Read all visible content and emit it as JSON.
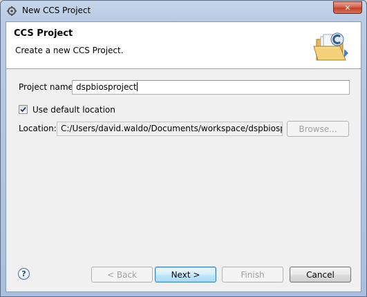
{
  "window": {
    "title": "New CCS Project",
    "close_symbol": "✕"
  },
  "header": {
    "title": "CCS Project",
    "description": "Create a new CCS Project.",
    "banner_icon": "folder-wizard-icon"
  },
  "form": {
    "project_name_label": "Project name:",
    "project_name_value": "dspbiosproject",
    "use_default_label": "Use default location",
    "use_default_checked": true,
    "location_label": "Location:",
    "location_value": "C:/Users/david.waldo/Documents/workspace/dspbiosprojec",
    "browse_label": "Browse..."
  },
  "buttons": {
    "help_symbol": "?",
    "back_label": "< Back",
    "next_label": "Next >",
    "finish_label": "Finish",
    "cancel_label": "Cancel"
  },
  "colors": {
    "default_button_border": "#3c7fb1",
    "close_button": "#c2412a",
    "title_bar": "#b9cbe4"
  }
}
